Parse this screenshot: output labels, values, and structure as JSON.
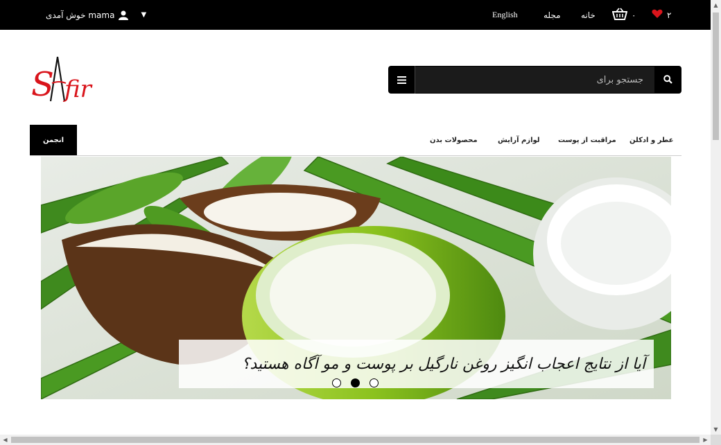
{
  "topbar": {
    "welcome_text": "خوش آمدی mama",
    "language": "English",
    "magazine": "مجله",
    "home": "خانه",
    "cart_count": "۰",
    "wishlist_count": "۲"
  },
  "logo": {
    "text": "SAfir"
  },
  "search": {
    "placeholder": "جستجو برای"
  },
  "nav": {
    "active": "انجمن",
    "items": [
      "محصولات بدن",
      "لوازم آرایش",
      "مراقبت از پوست",
      "عطر و ادکلن"
    ]
  },
  "hero": {
    "caption": "آیا از نتایج اعجاب انگیز روغن نارگیل بر پوست و مو آگاه هستید؟",
    "active_slide": 2,
    "slide_count": 3
  },
  "colors": {
    "topbar": "#000000",
    "accent": "#d9141b",
    "leaf": "#3f8a1e"
  }
}
